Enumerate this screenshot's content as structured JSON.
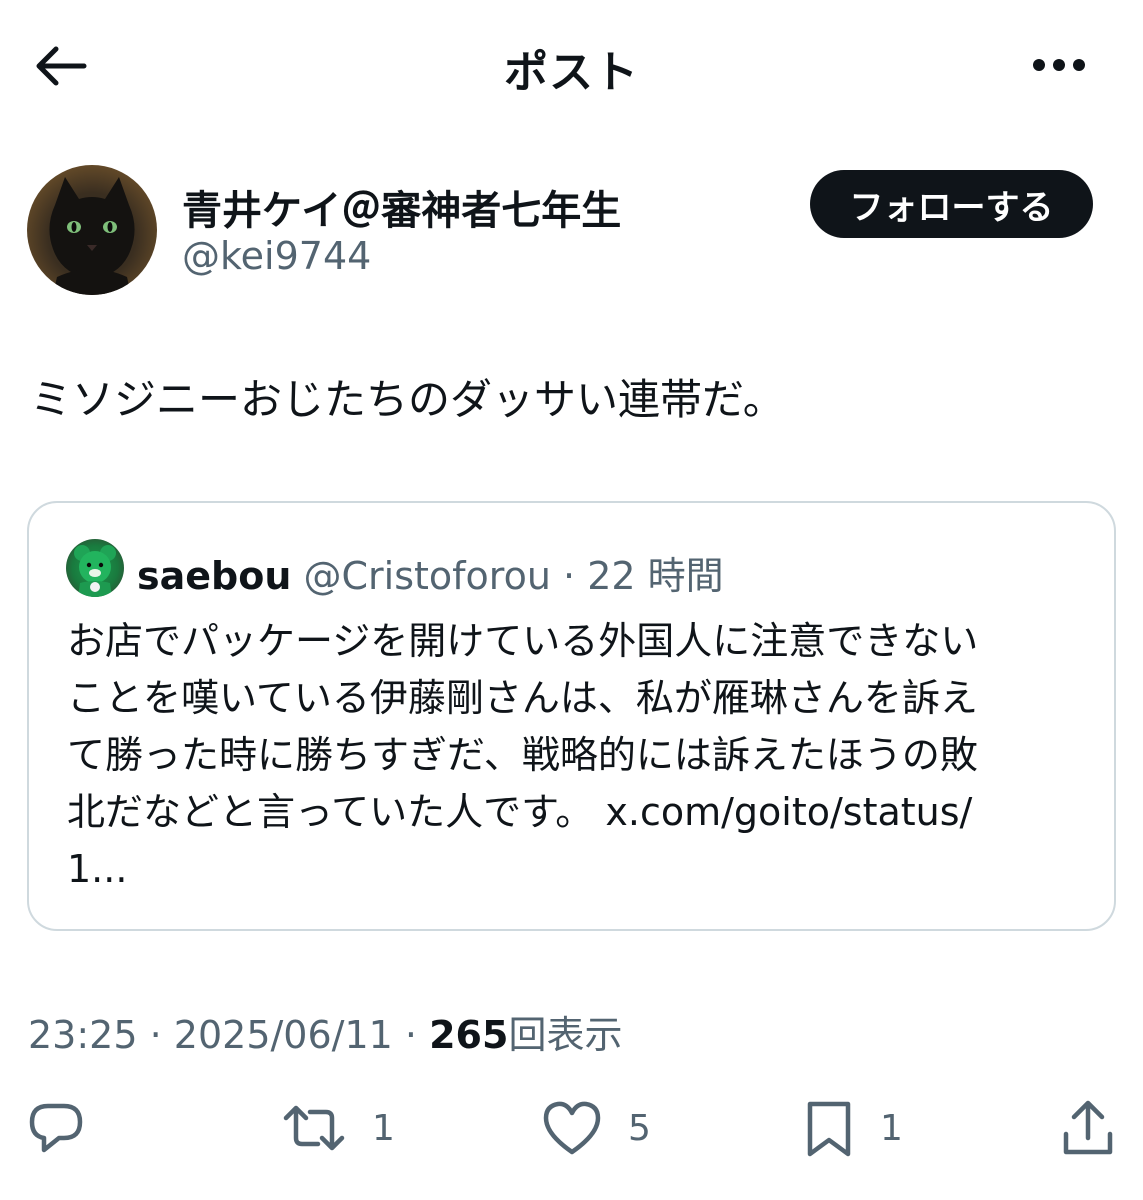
{
  "header": {
    "title": "ポスト",
    "back_icon": "arrow-left-icon",
    "more_icon": "more-horizontal-icon"
  },
  "author": {
    "display_name": "青井ケイ＠審神者七年生",
    "handle": "@kei9744",
    "avatar": "black-cat-avatar"
  },
  "follow_button": {
    "label": "フォローする"
  },
  "post": {
    "text": "ミソジニーおじたちのダッサい連帯だ。"
  },
  "quote": {
    "author_name": "saebou",
    "author_handle": "@Cristoforou",
    "separator": "·",
    "time": "22 時間",
    "avatar": "green-bear-avatar",
    "lines": [
      "お店でパッケージを開けている外国人に注意できない",
      "ことを嘆いている伊藤剛さんは、私が雁琳さんを訴え",
      "て勝った時に勝ちすぎだ、戦略的には訴えたほうの敗",
      "北だなどと言っていた人です。 x.com/goito/status/",
      "1..."
    ]
  },
  "meta": {
    "time": "23:25",
    "separator": "·",
    "date": "2025/06/11",
    "views_count": "265",
    "views_label": "回表示"
  },
  "actions": {
    "reply": {
      "icon": "reply-icon",
      "count": ""
    },
    "repost": {
      "icon": "repost-icon",
      "count": "1"
    },
    "like": {
      "icon": "heart-icon",
      "count": "5"
    },
    "bookmark": {
      "icon": "bookmark-icon",
      "count": "1"
    },
    "share": {
      "icon": "share-icon"
    }
  },
  "colors": {
    "text_primary": "#0f1419",
    "text_secondary": "#536471",
    "border": "#cfd9de",
    "follow_bg": "#0f1419"
  }
}
